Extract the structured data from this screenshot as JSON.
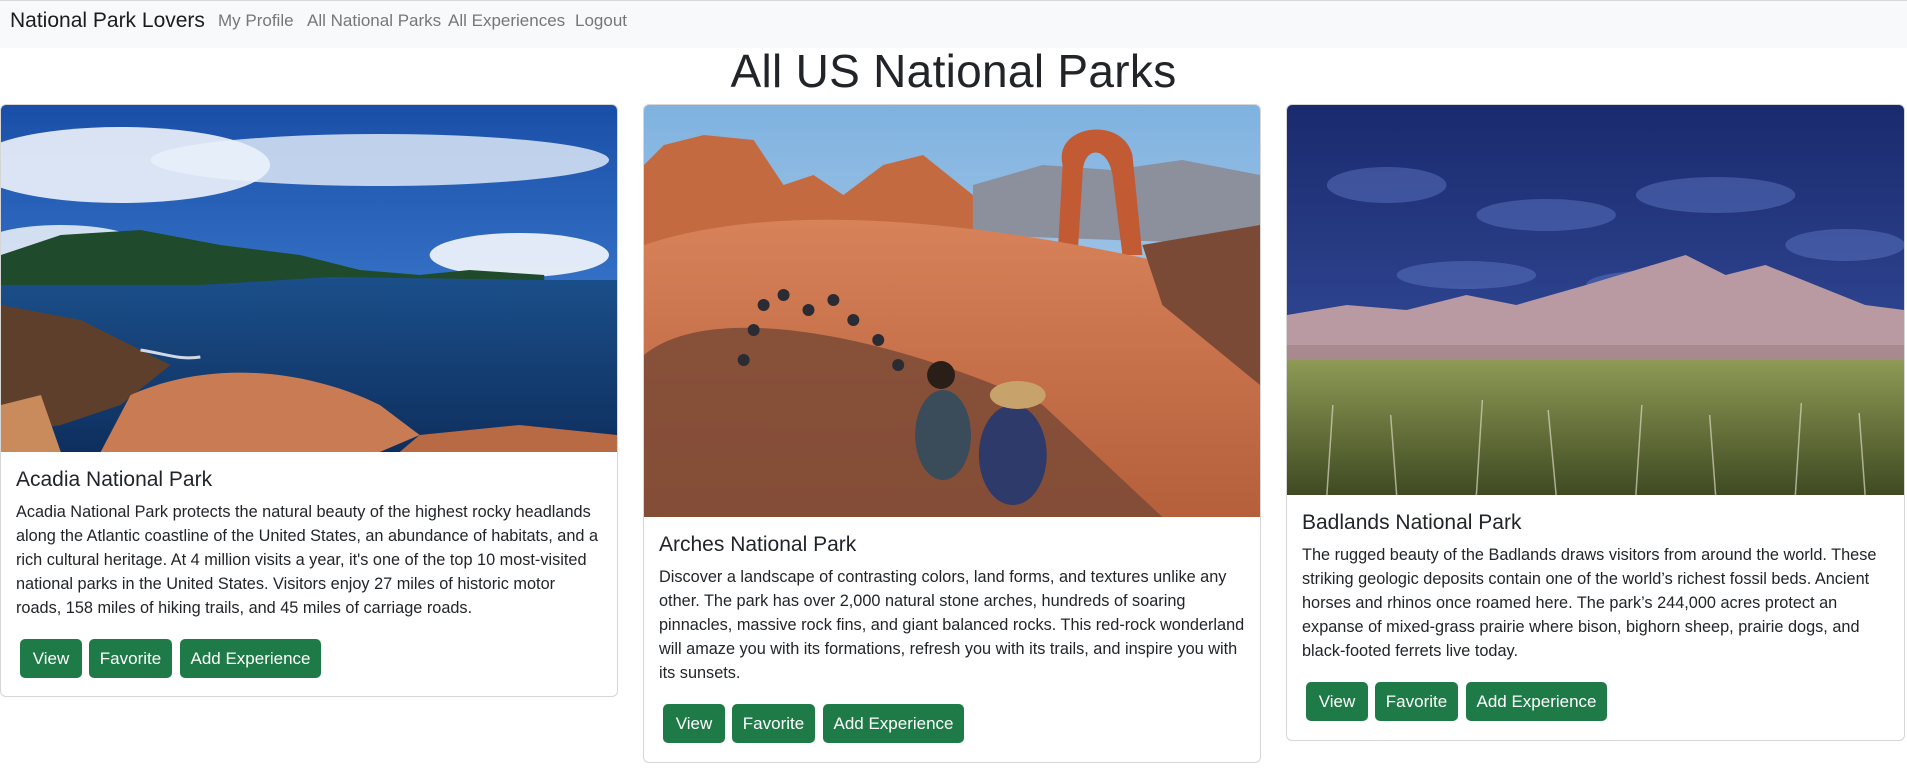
{
  "nav": {
    "brand": "National Park Lovers",
    "links": [
      "My Profile",
      "All National Parks",
      "All Experiences",
      "Logout"
    ]
  },
  "page": {
    "title": "All US National Parks"
  },
  "parks": [
    {
      "title": "Acadia National Park",
      "description": "Acadia National Park protects the natural beauty of the highest rocky headlands along the Atlantic coastline of the United States, an abundance of habitats, and a rich cultural heritage. At 4 million visits a year, it's one of the top 10 most-visited national parks in the United States. Visitors enjoy 27 miles of historic motor roads, 158 miles of hiking trails, and 45 miles of carriage roads."
    },
    {
      "title": "Arches National Park",
      "description": "Discover a landscape of contrasting colors, land forms, and textures unlike any other. The park has over 2,000 natural stone arches, hundreds of soaring pinnacles, massive rock fins, and giant balanced rocks. This red-rock wonderland will amaze you with its formations, refresh you with its trails, and inspire you with its sunsets."
    },
    {
      "title": "Badlands National Park",
      "description": "The rugged beauty of the Badlands draws visitors from around the world. These striking geologic deposits contain one of the world’s richest fossil beds. Ancient horses and rhinos once roamed here. The park’s 244,000 acres protect an expanse of mixed-grass prairie where bison, bighorn sheep, prairie dogs, and black-footed ferrets live today."
    }
  ],
  "buttons": {
    "view": "View",
    "favorite": "Favorite",
    "add_experience": "Add Experience"
  },
  "colors": {
    "button": "#1e7a47",
    "navbar_bg": "#f8f9fa",
    "nav_link": "#777777"
  }
}
